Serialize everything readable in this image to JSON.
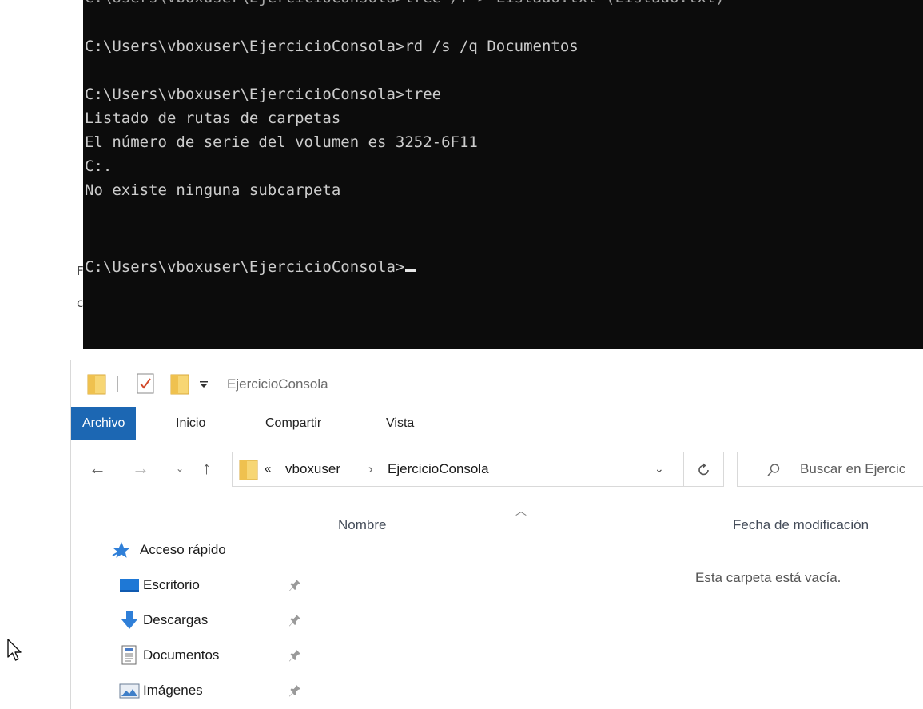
{
  "console": {
    "top_cut_text": "C:\\Users\\vboxuser\\EjercicioConsola>tree /f > Listado.txt (Listado.txt)",
    "lines": [
      "C:\\Users\\vboxuser\\EjercicioConsola>rd /s /q Documentos",
      "",
      "C:\\Users\\vboxuser\\EjercicioConsola>tree",
      "Listado de rutas de carpetas",
      "El número de serie del volumen es 3252-6F11",
      "C:.",
      "No existe ninguna subcarpeta",
      "",
      "",
      "C:\\Users\\vboxuser\\EjercicioConsola>"
    ],
    "background": "#0c0c0c",
    "text_color": "#cccccc"
  },
  "background_doc": {
    "glyphs": [
      "F",
      "c"
    ]
  },
  "explorer": {
    "title": "EjercicioConsola",
    "ribbon_tabs": [
      "Archivo",
      "Inicio",
      "Compartir",
      "Vista"
    ],
    "accent": "#1c67b3",
    "breadcrumb": {
      "overflow": "«",
      "items": [
        "vboxuser",
        "EjercicioConsola"
      ],
      "separator": "›"
    },
    "search_placeholder": "Buscar en Ejercic",
    "columns": [
      "Nombre",
      "Fecha de modificación"
    ],
    "empty_message": "Esta carpeta está vacía.",
    "nav": {
      "quick_access": "Acceso rápido",
      "items": [
        {
          "label": "Escritorio",
          "icon": "desktop-icon"
        },
        {
          "label": "Descargas",
          "icon": "downloads-icon"
        },
        {
          "label": "Documentos",
          "icon": "documents-icon"
        },
        {
          "label": "Imágenes",
          "icon": "pictures-icon"
        }
      ]
    }
  }
}
